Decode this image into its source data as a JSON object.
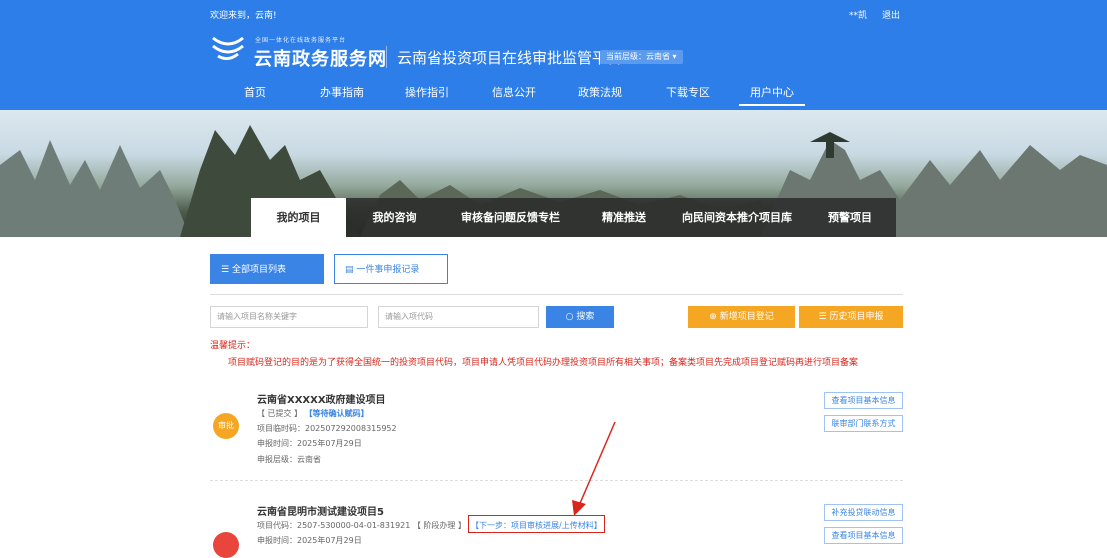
{
  "header": {
    "welcome": "欢迎来到，云南!",
    "user": "**凯",
    "logout": "退出",
    "slogan": "全国一体化在线政务服务平台",
    "site_name": "云南政务服务网",
    "platform": "云南省投资项目在线审批监管平台",
    "level_label": "当前层级：",
    "level_value": "云南省",
    "level_caret": "▾"
  },
  "nav": [
    "首页",
    "办事指南",
    "操作指引",
    "信息公开",
    "政策法规",
    "下载专区",
    "用户中心"
  ],
  "tabs": [
    "我的项目",
    "我的咨询",
    "审核备问题反馈专栏",
    "精准推送",
    "向民间资本推介项目库",
    "预警项目"
  ],
  "subtabs": {
    "all_projects": "全部项目列表",
    "one_thing": "一件事申报记录"
  },
  "search": {
    "name_placeholder": "请输入项目名称关键字",
    "code_placeholder": "请输入项代码",
    "search_label": "搜索",
    "new_label": "新增项目登记",
    "history_label": "历史项目申报"
  },
  "tip": {
    "title": "温馨提示：",
    "body": "项目赋码登记的目的是为了获得全国统一的投资项目代码，项目申请人凭项目代码办理投资项目所有相关事项；备案类项目先完成项目登记赋码再进行项目备案"
  },
  "projects": [
    {
      "title": "云南省XXXXX政府建设项目",
      "status_open": "【 已提交 】",
      "status_highlight": "【等待确认赋码】",
      "temp_code": "项目临时码：202507292008315952",
      "apply_time": "申报时间：2025年07月29日",
      "level": "申报层级：云南省",
      "badge": "审批",
      "btn1": "查看项目基本信息",
      "btn2": "联审部门联系方式"
    },
    {
      "title": "云南省昆明市测试建设项目5",
      "code_line": "项目代码：2507-530000-04-01-831921 【 阶段办理 】",
      "next_step": "【下一步：项目审核进展/上传材料】",
      "apply_time": "申报时间：2025年07月29日",
      "btn1": "补充投贷联动信息",
      "btn2": "查看项目基本信息"
    }
  ],
  "colors": {
    "primary": "#2d7ee8",
    "accent_orange": "#f5a623",
    "alert_red": "#d9261c"
  }
}
